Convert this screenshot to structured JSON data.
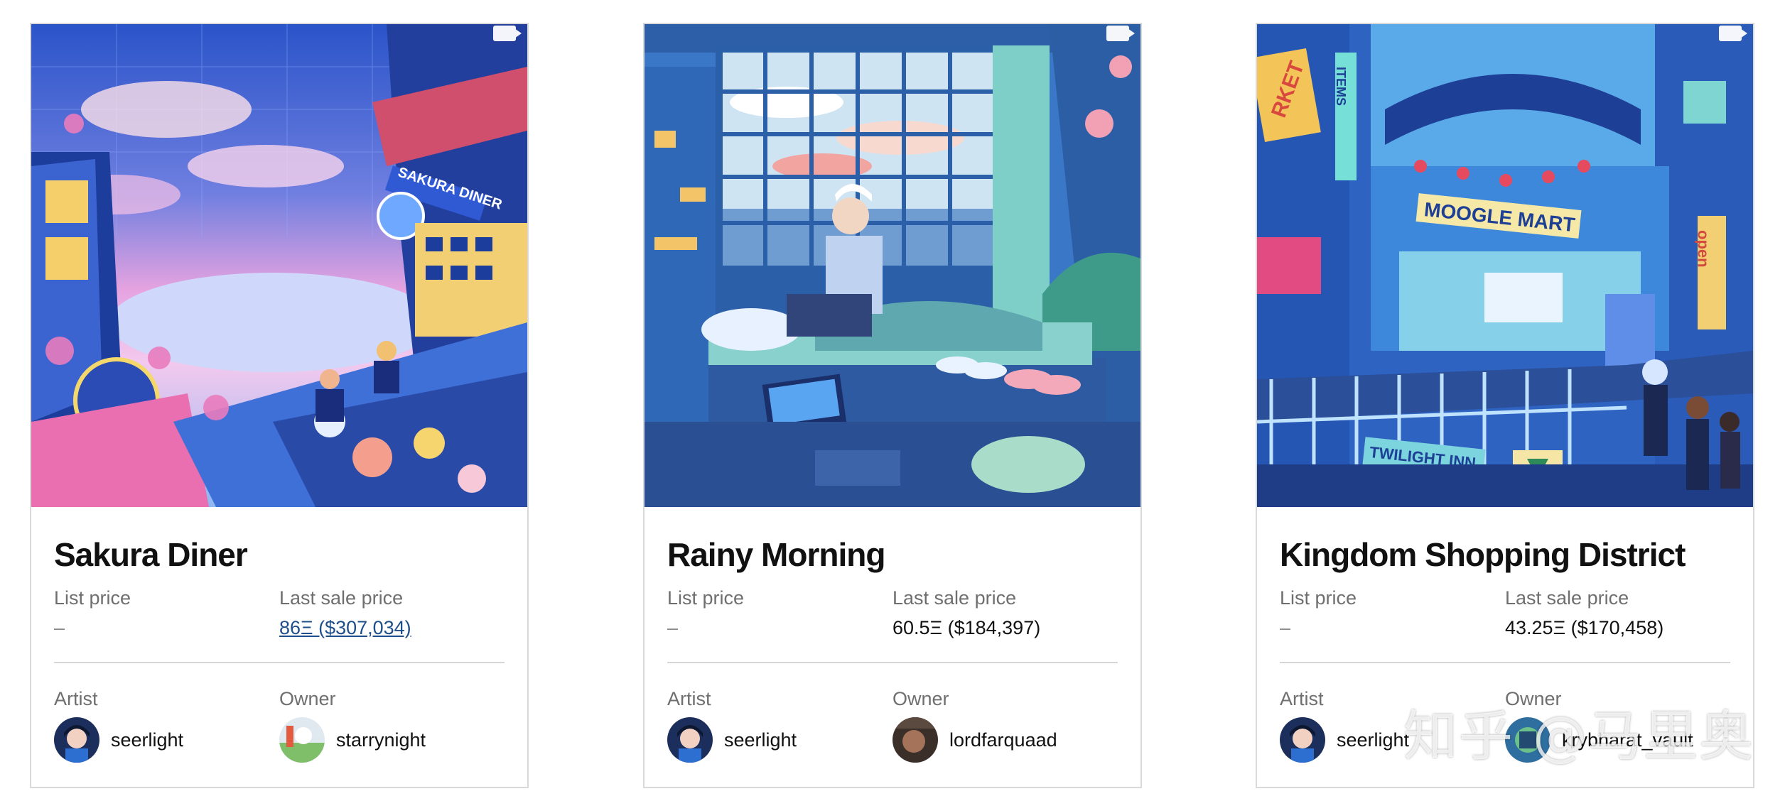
{
  "labels": {
    "list_price": "List price",
    "last_sale_price": "Last sale price",
    "artist": "Artist",
    "owner": "Owner"
  },
  "cards": [
    {
      "title": "Sakura Diner",
      "list_price": "–",
      "last_sale": "86Ξ ($307,034)",
      "artist": "seerlight",
      "owner": "starrynight"
    },
    {
      "title": "Rainy Morning",
      "list_price": "–",
      "last_sale": "60.5Ξ ($184,397)",
      "artist": "seerlight",
      "owner": "lordfarquaad"
    },
    {
      "title": "Kingdom Shopping District",
      "list_price": "–",
      "last_sale": "43.25Ξ ($170,458)",
      "artist": "seerlight",
      "owner": "krybharat_vault"
    }
  ],
  "artwork_text": {
    "sakura_sign": "SAKURA DINER",
    "moogle_sign": "MOOGLE MART",
    "twilight_sign": "TWILIGHT INN",
    "open_sign": "open",
    "items_sign": "ITEMS",
    "market_sign": "RKET"
  },
  "watermark": "知乎 @马里奥",
  "colors": {
    "link": "#1f4f8a",
    "border": "#d9d9d9"
  }
}
